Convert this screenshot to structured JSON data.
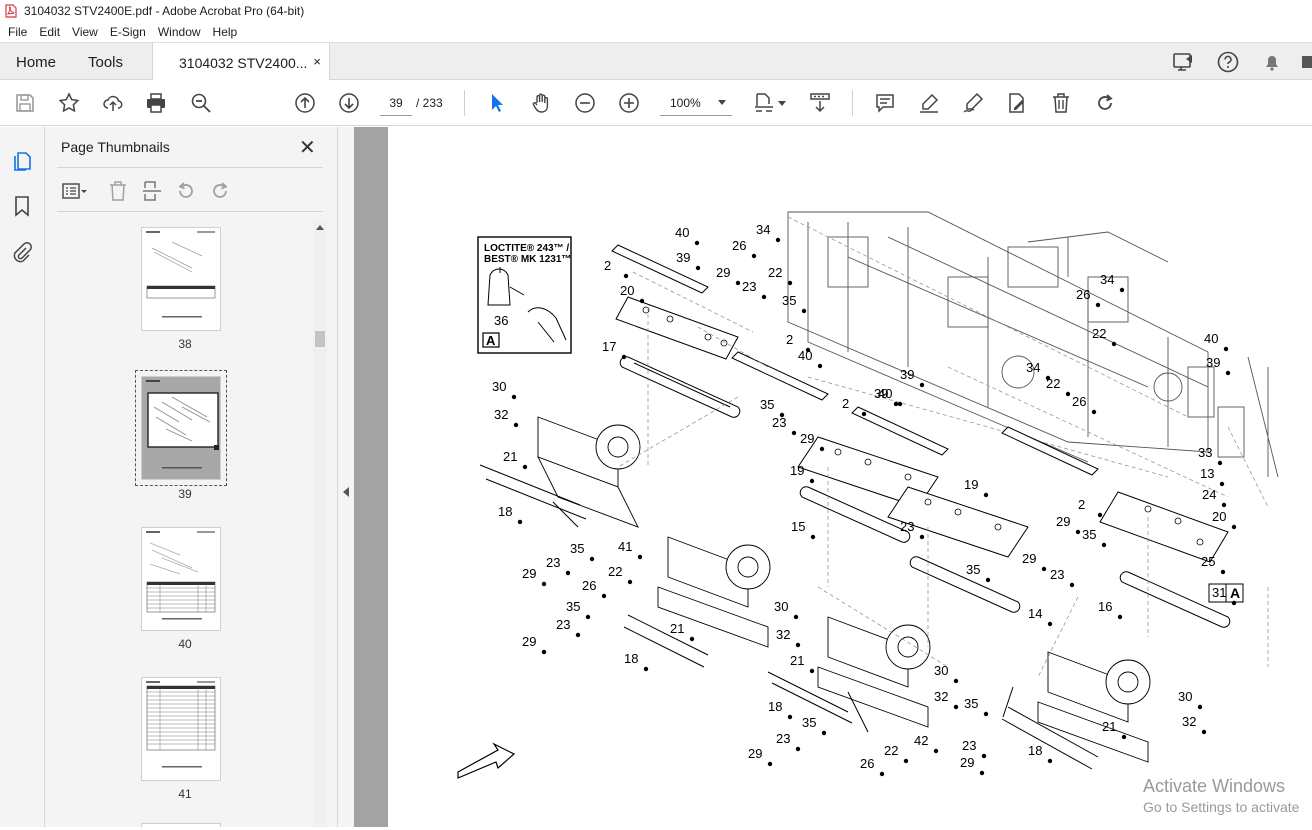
{
  "window": {
    "title": "3104032 STV2400E.pdf - Adobe Acrobat Pro (64-bit)"
  },
  "menu": [
    "File",
    "Edit",
    "View",
    "E-Sign",
    "Window",
    "Help"
  ],
  "tabs": {
    "home": "Home",
    "tools": "Tools",
    "doc": "3104032 STV2400...",
    "doc_close": "×"
  },
  "toolbar": {
    "page_current": "39",
    "page_total": "/ 233",
    "zoom": "100%"
  },
  "panel": {
    "title": "Page Thumbnails",
    "close": "✕",
    "thumbnails": [
      {
        "label": "38"
      },
      {
        "label": "39",
        "selected": true
      },
      {
        "label": "40"
      },
      {
        "label": "41"
      }
    ]
  },
  "drawing": {
    "loctite_line1": "LOCTITE® 243™ /",
    "loctite_line2": "BEST® MK 1231™",
    "loctite_part": "36",
    "view_box_label": "A",
    "callouts": [
      {
        "t": "40"
      },
      {
        "t": "26"
      },
      {
        "t": "34"
      },
      {
        "t": "39"
      },
      {
        "t": "22"
      },
      {
        "t": "2"
      },
      {
        "t": "29"
      },
      {
        "t": "23"
      },
      {
        "t": "35"
      },
      {
        "t": "20"
      },
      {
        "t": "34"
      },
      {
        "t": "26"
      },
      {
        "t": "22"
      },
      {
        "t": "40"
      },
      {
        "t": "39"
      },
      {
        "t": "2"
      },
      {
        "t": "40"
      },
      {
        "t": "39"
      },
      {
        "t": "17"
      },
      {
        "t": "30"
      },
      {
        "t": "32"
      },
      {
        "t": "35"
      },
      {
        "t": "23"
      },
      {
        "t": "29"
      },
      {
        "t": "34"
      },
      {
        "t": "22"
      },
      {
        "t": "26"
      },
      {
        "t": "2"
      },
      {
        "t": "40"
      },
      {
        "t": "39"
      },
      {
        "t": "21"
      },
      {
        "t": "19"
      },
      {
        "t": "19"
      },
      {
        "t": "33"
      },
      {
        "t": "13"
      },
      {
        "t": "18"
      },
      {
        "t": "35"
      },
      {
        "t": "23"
      },
      {
        "t": "29"
      },
      {
        "t": "2"
      },
      {
        "t": "24"
      },
      {
        "t": "15"
      },
      {
        "t": "20"
      },
      {
        "t": "35"
      },
      {
        "t": "29"
      },
      {
        "t": "23"
      },
      {
        "t": "41"
      },
      {
        "t": "35"
      },
      {
        "t": "25"
      },
      {
        "t": "23"
      },
      {
        "t": "29"
      },
      {
        "t": "22"
      },
      {
        "t": "26"
      },
      {
        "t": "16"
      },
      {
        "t": "31"
      },
      {
        "t": "35"
      },
      {
        "t": "30"
      },
      {
        "t": "14"
      },
      {
        "t": "23"
      },
      {
        "t": "21"
      },
      {
        "t": "32"
      },
      {
        "t": "29"
      },
      {
        "t": "18"
      },
      {
        "t": "21"
      },
      {
        "t": "30"
      },
      {
        "t": "32"
      },
      {
        "t": "18"
      },
      {
        "t": "35"
      },
      {
        "t": "30"
      },
      {
        "t": "35"
      },
      {
        "t": "21"
      },
      {
        "t": "32"
      },
      {
        "t": "23"
      },
      {
        "t": "22"
      },
      {
        "t": "42"
      },
      {
        "t": "23"
      },
      {
        "t": "29"
      },
      {
        "t": "26"
      },
      {
        "t": "18"
      },
      {
        "t": "29"
      }
    ],
    "callout_31_box": "A"
  },
  "watermark": {
    "line1": "Activate Windows",
    "line2": "Go to Settings to activate"
  },
  "colors": {
    "accent_blue": "#1473e6",
    "pdf_red": "#d7373f",
    "chrome_gray": "#eeeeee",
    "doc_gray": "#a3a3a3"
  }
}
